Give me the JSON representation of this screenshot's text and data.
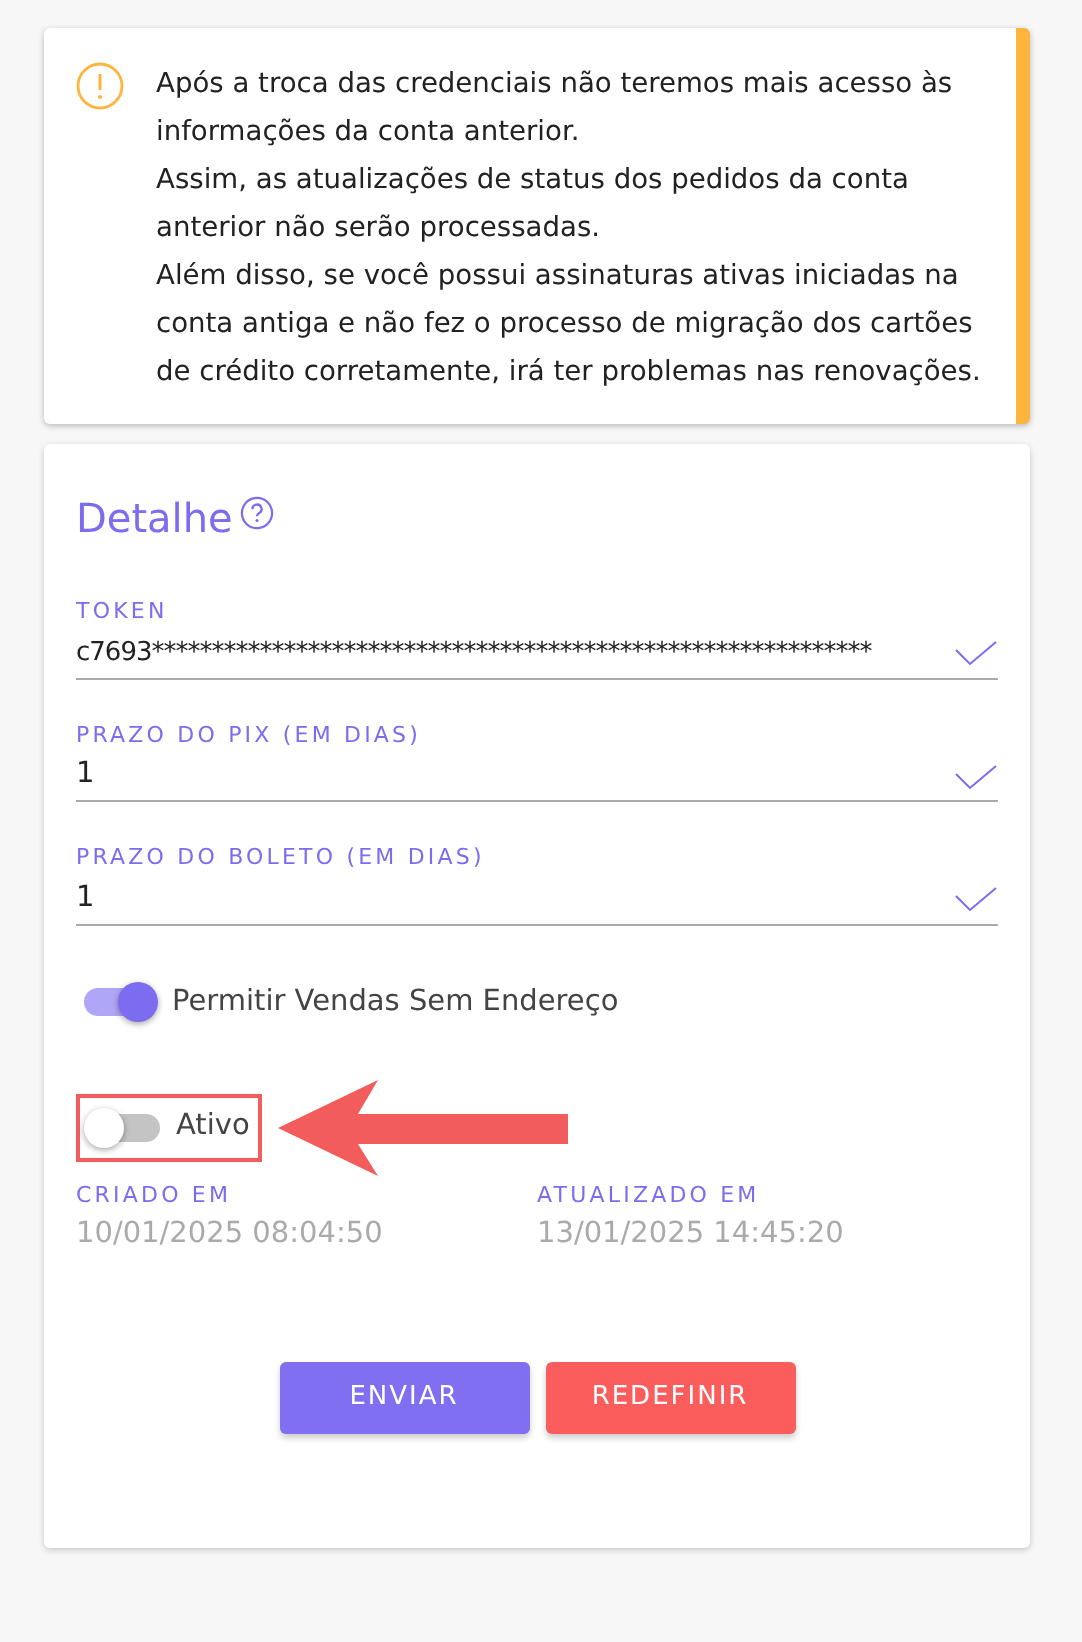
{
  "alert": {
    "paragraphs": [
      "Após a troca das credenciais não teremos mais acesso às informações da conta anterior.",
      "Assim, as atualizações de status dos pedidos da conta anterior não serão processadas.",
      "Além disso, se você possui assinaturas ativas iniciadas na conta antiga e não fez o processo de migração dos cartões de crédito corretamente, irá ter problemas nas renovações."
    ]
  },
  "detail": {
    "title": "Detalhe",
    "fields": [
      {
        "label": "TOKEN",
        "value": "c7693************************************************************",
        "valid": true
      },
      {
        "label": "PRAZO DO PIX (EM DIAS)",
        "value": "1",
        "valid": true
      },
      {
        "label": "PRAZO DO BOLETO (EM DIAS)",
        "value": "1",
        "valid": true
      }
    ],
    "toggles": [
      {
        "label": "Permitir Vendas Sem Endereço",
        "on": true,
        "kind": "plain"
      },
      {
        "label": "Ativo",
        "on": false,
        "kind": "callout"
      }
    ],
    "dates": [
      {
        "label": "CRIADO EM",
        "value": "10/01/2025 08:04:50"
      },
      {
        "label": "ATUALIZADO EM",
        "value": "13/01/2025 14:45:20"
      }
    ],
    "buttons": [
      {
        "label": "ENVIAR",
        "kind": "primary"
      },
      {
        "label": "REDEFINIR",
        "kind": "reset"
      }
    ]
  }
}
